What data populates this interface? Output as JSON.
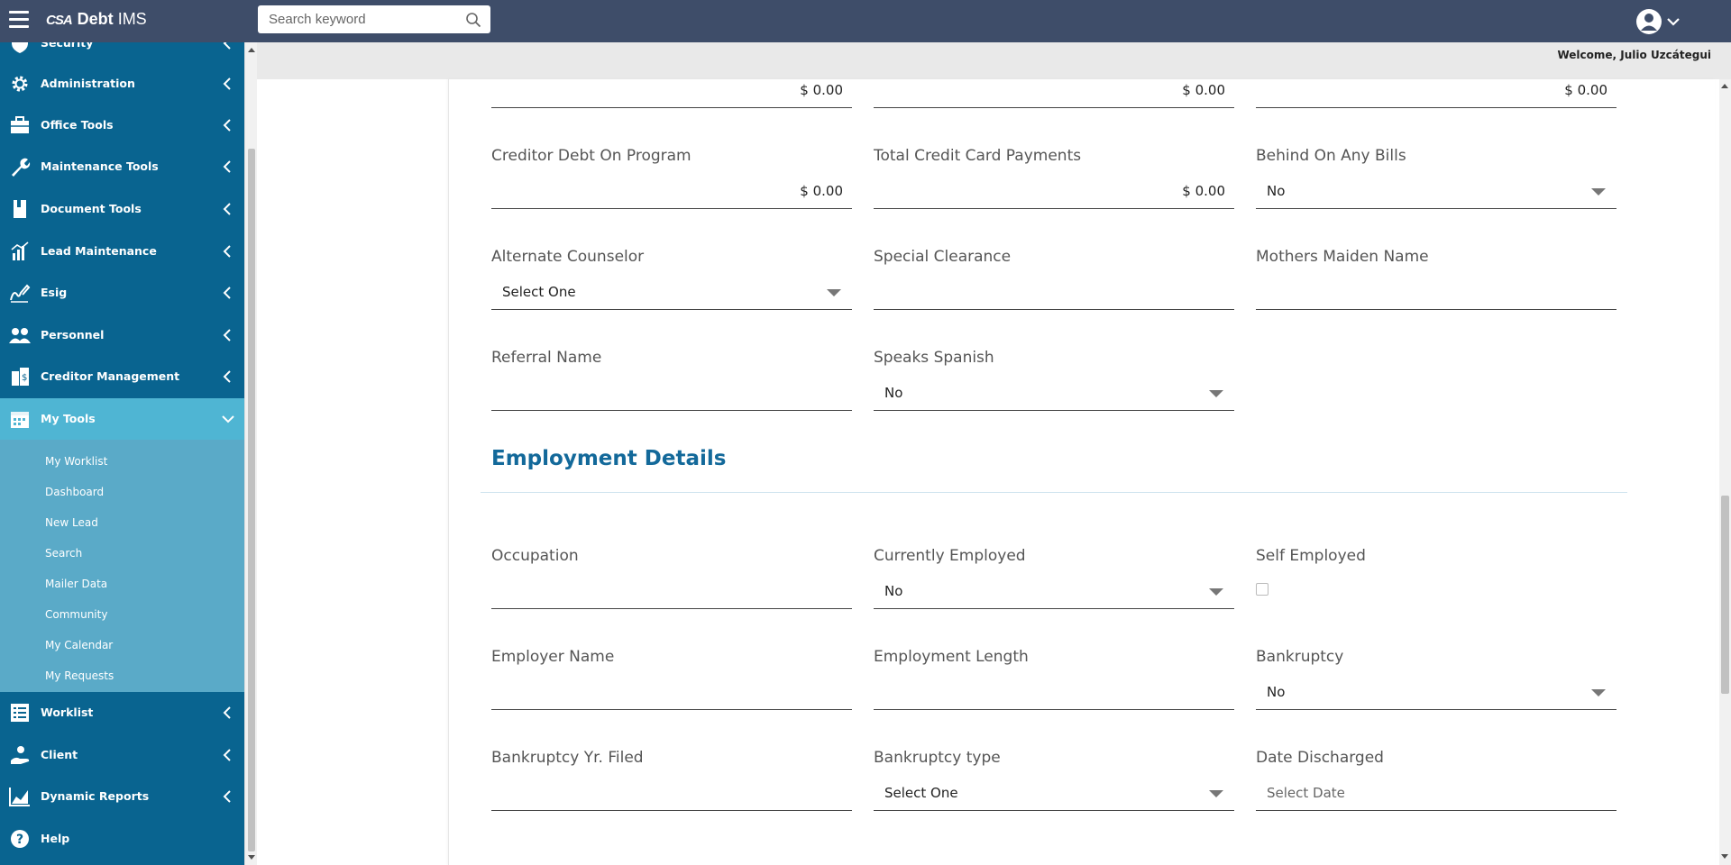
{
  "app": {
    "logo_mark": "CSA",
    "logo_title": "Debt",
    "logo_suffix": "IMS"
  },
  "search": {
    "placeholder": "Search keyword"
  },
  "header": {
    "welcome": "Welcome, Julio Uzcátegui"
  },
  "sidebar": {
    "items": [
      {
        "label": "Security",
        "icon": "shield-icon"
      },
      {
        "label": "Administration",
        "icon": "gear-icon"
      },
      {
        "label": "Office Tools",
        "icon": "briefcase-icon"
      },
      {
        "label": "Maintenance Tools",
        "icon": "wrench-icon"
      },
      {
        "label": "Document Tools",
        "icon": "document-icon"
      },
      {
        "label": "Lead Maintenance",
        "icon": "chart-icon"
      },
      {
        "label": "Esig",
        "icon": "signature-icon"
      },
      {
        "label": "Personnel",
        "icon": "people-icon"
      },
      {
        "label": "Creditor Management",
        "icon": "creditor-icon"
      },
      {
        "label": "My Tools",
        "icon": "calendar-icon"
      },
      {
        "label": "Worklist",
        "icon": "list-icon"
      },
      {
        "label": "Client",
        "icon": "client-icon"
      },
      {
        "label": "Dynamic Reports",
        "icon": "reports-icon"
      },
      {
        "label": "Help",
        "icon": "help-icon"
      }
    ],
    "my_tools_sub": [
      "My Worklist",
      "Dashboard",
      "New Lead",
      "Search",
      "Mailer Data",
      "Community",
      "My Calendar",
      "My Requests"
    ]
  },
  "form": {
    "top_row": [
      "$ 0.00",
      "$ 0.00",
      "$ 0.00"
    ],
    "creditor_debt": {
      "label": "Creditor Debt On Program",
      "value": "$ 0.00"
    },
    "total_cc_payments": {
      "label": "Total Credit Card Payments",
      "value": "$ 0.00"
    },
    "behind_bills": {
      "label": "Behind On Any Bills",
      "value": "No"
    },
    "alternate_counselor": {
      "label": "Alternate Counselor",
      "value": "Select One"
    },
    "special_clearance": {
      "label": "Special Clearance",
      "value": ""
    },
    "mothers_maiden": {
      "label": "Mothers Maiden Name",
      "value": ""
    },
    "referral_name": {
      "label": "Referral Name",
      "value": ""
    },
    "speaks_spanish": {
      "label": "Speaks Spanish",
      "value": "No"
    },
    "employment_title": "Employment Details",
    "occupation": {
      "label": "Occupation",
      "value": ""
    },
    "currently_employed": {
      "label": "Currently Employed",
      "value": "No"
    },
    "self_employed": {
      "label": "Self Employed",
      "checked": false
    },
    "employer_name": {
      "label": "Employer Name",
      "value": ""
    },
    "employment_length": {
      "label": "Employment Length",
      "value": ""
    },
    "bankruptcy": {
      "label": "Bankruptcy",
      "value": "No"
    },
    "bankruptcy_yr": {
      "label": "Bankruptcy Yr. Filed",
      "value": ""
    },
    "bankruptcy_type": {
      "label": "Bankruptcy type",
      "value": "Select One"
    },
    "date_discharged": {
      "label": "Date Discharged",
      "placeholder": "Select Date"
    }
  }
}
